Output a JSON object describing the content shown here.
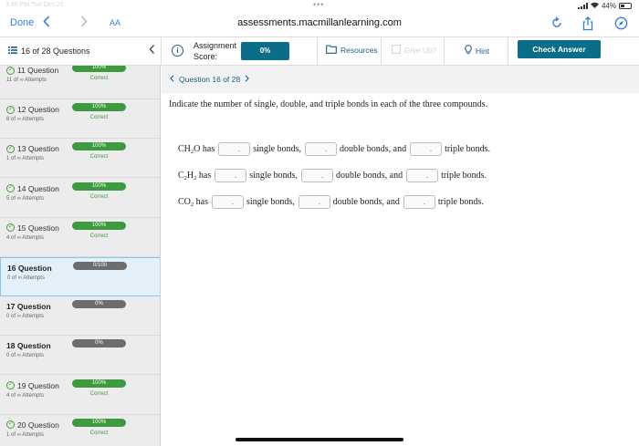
{
  "statusbar": {
    "time": "3:46 PM   Tue Dec 22",
    "battery": "44%",
    "battery_level": 0.44
  },
  "browser": {
    "done_label": "Done",
    "text_size_label": "AA",
    "url": "assessments.macmillanlearning.com"
  },
  "header": {
    "question_count": "16 of 28 Questions",
    "score_label_line1": "Assignment",
    "score_label_line2": "Score:",
    "score_value": "0%",
    "resources_label": "Resources",
    "giveup_label": "Give Up?",
    "hint_label": "Hint",
    "check_label": "Check Answer"
  },
  "sidebar": {
    "items": [
      {
        "title": "11 Question",
        "attempts": "11 of ∞ Attempts",
        "pill": "100%",
        "status": "Correct",
        "state": "correct"
      },
      {
        "title": "12 Question",
        "attempts": "6 of ∞ Attempts",
        "pill": "100%",
        "status": "Correct",
        "state": "correct"
      },
      {
        "title": "13 Question",
        "attempts": "1 of ∞ Attempts",
        "pill": "100%",
        "status": "Correct",
        "state": "correct"
      },
      {
        "title": "14 Question",
        "attempts": "5 of ∞ Attempts",
        "pill": "100%",
        "status": "Correct",
        "state": "correct"
      },
      {
        "title": "15 Question",
        "attempts": "4 of ∞ Attempts",
        "pill": "100%",
        "status": "Correct",
        "state": "correct"
      },
      {
        "title": "16 Question",
        "attempts": "0 of ∞ Attempts",
        "pill": "0/100",
        "status": "",
        "state": "active"
      },
      {
        "title": "17 Question",
        "attempts": "0 of ∞ Attempts",
        "pill": "0%",
        "status": "",
        "state": "open"
      },
      {
        "title": "18 Question",
        "attempts": "0 of ∞ Attempts",
        "pill": "0%",
        "status": "",
        "state": "open"
      },
      {
        "title": "19 Question",
        "attempts": "4 of ∞ Attempts",
        "pill": "100%",
        "status": "Correct",
        "state": "correct"
      },
      {
        "title": "20 Question",
        "attempts": "1 of ∞ Attempts",
        "pill": "100%",
        "status": "Correct",
        "state": "correct"
      }
    ]
  },
  "main": {
    "question_nav": "Question 16 of 28",
    "prompt": "Indicate the number of single, double, and triple bonds in each of the three compounds.",
    "rows": [
      {
        "compound": "CH₂O",
        "has": "has",
        "single": "single bonds,",
        "double": "double bonds, and",
        "triple": "triple bonds."
      },
      {
        "compound": "C₂H₂",
        "has": "has",
        "single": "single bonds,",
        "double": "double bonds, and",
        "triple": "triple bonds."
      },
      {
        "compound": "CO₂",
        "has": "has",
        "single": "single bonds,",
        "double": "double bonds, and",
        "triple": "triple bonds."
      }
    ]
  },
  "colors": {
    "accent": "#0a6e8a",
    "link": "#1a5f8a",
    "correct": "#3d9a3f",
    "safari_blue": "#2f7de1"
  }
}
